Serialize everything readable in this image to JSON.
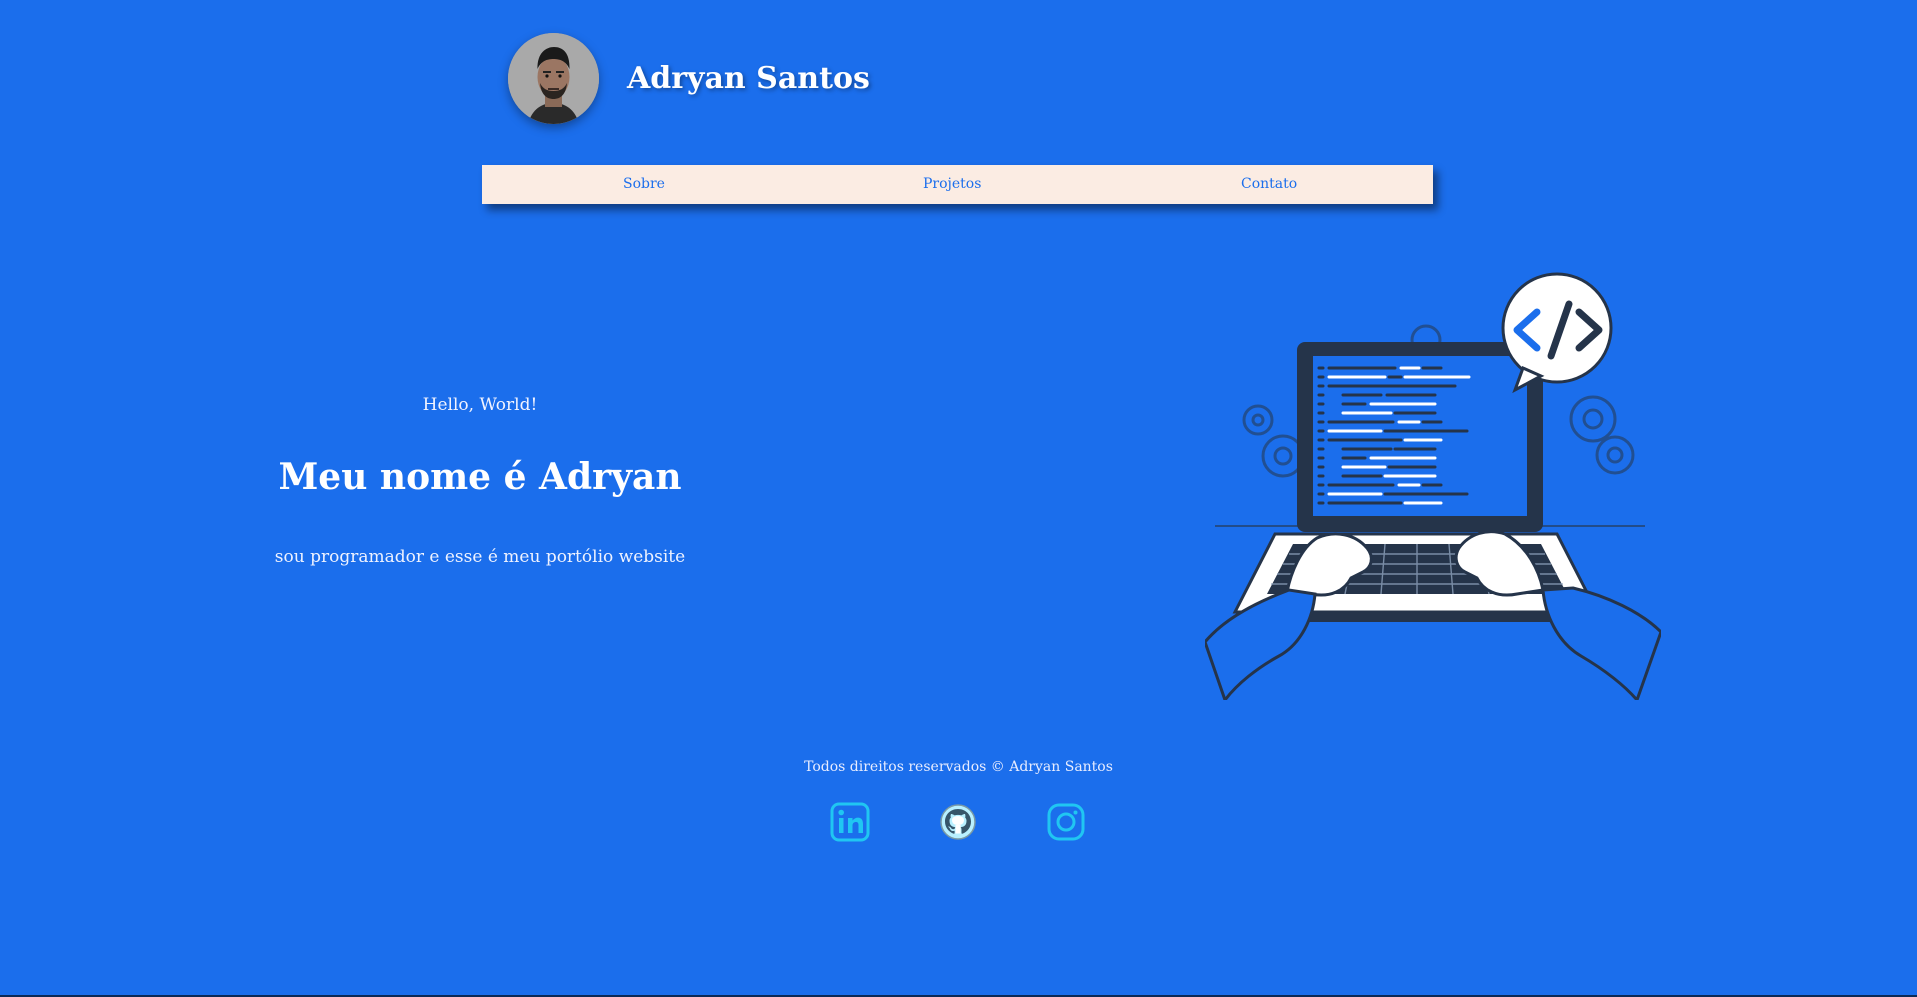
{
  "header": {
    "name": "Adryan Santos",
    "avatar_icon": "profile-photo"
  },
  "nav": {
    "items": [
      {
        "label": "Sobre"
      },
      {
        "label": "Projetos"
      },
      {
        "label": "Contato"
      }
    ]
  },
  "hero": {
    "greeting": "Hello, World!",
    "headline": "Meu nome é Adryan",
    "tagline": "sou programador e esse é meu portólio website"
  },
  "illustration": {
    "icon": "developer-laptop-illustration",
    "bubble_text": "</>"
  },
  "footer": {
    "copyright": "Todos direitos reservados © Adryan Santos",
    "social": [
      {
        "icon": "linkedin-icon"
      },
      {
        "icon": "github-icon"
      },
      {
        "icon": "instagram-icon"
      }
    ]
  },
  "colors": {
    "background": "#1b6eec",
    "nav_background": "#fbece3",
    "accent": "#1b6eec",
    "icon_cyan": "#20c6f2"
  }
}
